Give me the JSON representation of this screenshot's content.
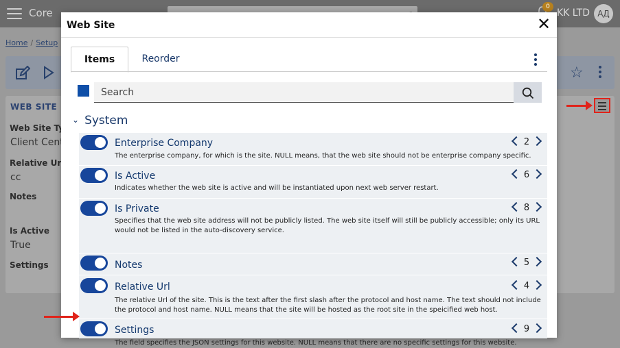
{
  "app": {
    "name": "Core",
    "company": "KK LTD",
    "user_initials": "АД",
    "notification_count": "0"
  },
  "breadcrumb": {
    "home": "Home",
    "sep": "/",
    "setup": "Setup"
  },
  "background": {
    "section_title": "WEB SITE",
    "fields": [
      {
        "label": "Web Site Typ",
        "value": "Client Cente"
      },
      {
        "label": "Relative Url",
        "value": "cc"
      },
      {
        "label": "Notes",
        "value": ""
      },
      {
        "label": "Is Active",
        "value": "True"
      },
      {
        "label": "Settings",
        "value": ""
      }
    ]
  },
  "modal": {
    "title": "Web Site",
    "close_glyph": "✕",
    "tabs": [
      {
        "label": "Items",
        "active": true
      },
      {
        "label": "Reorder",
        "active": false
      }
    ],
    "search": {
      "placeholder": "Search",
      "value": ""
    },
    "group": {
      "label": "System",
      "chevron": "⌄"
    },
    "rows": [
      {
        "name": "Enterprise Company",
        "order": "2",
        "enabled": true,
        "description": "The enterprise company, for which is the site. NULL means, that the web site should not be enterprise company specific."
      },
      {
        "name": "Is Active",
        "order": "6",
        "enabled": true,
        "description": "Indicates whether the web site is active and will be instantiated upon next web server restart."
      },
      {
        "name": "Is Private",
        "order": "8",
        "enabled": true,
        "description": "Specifies that the web site address will not be publicly listed. The web site itself will still be publicly accessible; only its URL would not be listed in the auto-discovery service."
      },
      {
        "name": "Notes",
        "order": "5",
        "enabled": true,
        "description": ""
      },
      {
        "name": "Relative Url",
        "order": "4",
        "enabled": true,
        "description": "The relative Url of the site. This is the text after the first slash after the protocol and host name. The text should not include the protocol and host name. NULL means that the site will be hosted as the root site in the speicified web host."
      },
      {
        "name": "Settings",
        "order": "9",
        "enabled": true,
        "description": "The field specifies the JSON settings for this website. NULL means that there are no specific settings for this website."
      }
    ]
  },
  "colors": {
    "accent": "#17469b",
    "arrow": "#e0231a",
    "link": "#14396e"
  }
}
